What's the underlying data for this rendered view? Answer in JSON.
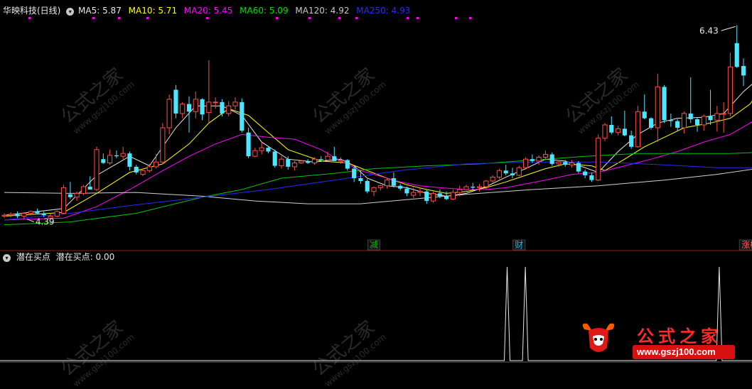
{
  "header": {
    "stock": "华映科技(日线)",
    "ma": [
      {
        "label": "MA5:",
        "value": "5.87",
        "color": "#ffffff"
      },
      {
        "label": "MA10:",
        "value": "5.71",
        "color": "#ffff00"
      },
      {
        "label": "MA20:",
        "value": "5.45",
        "color": "#ff00ff"
      },
      {
        "label": "MA60:",
        "value": "5.09",
        "color": "#00ff00"
      },
      {
        "label": "MA120:",
        "value": "4.92",
        "color": "#c0c0c0"
      },
      {
        "label": "MA250:",
        "value": "4.93",
        "color": "#2020ff"
      }
    ]
  },
  "sub_header": {
    "name": "潜在买点",
    "label": "潜在买点:",
    "value": "0.00"
  },
  "annotations": {
    "high": "6.43",
    "low": "4.39",
    "tags": [
      {
        "text": "减",
        "color": "#00c000"
      },
      {
        "text": "财",
        "color": "#00c0ff"
      },
      {
        "text": "涨榜",
        "color": "#ff6060"
      }
    ]
  },
  "watermark": {
    "cn": "公式之家",
    "url": "www.gszj100.com"
  },
  "logo": {
    "cn": "公式之家",
    "url": "www.gszj100.com"
  },
  "colors": {
    "up": "#ff4d4d",
    "down": "#4de6ff",
    "background": "#000000",
    "divider": "#a01818"
  },
  "chart_data": {
    "type": "candlestick",
    "ylim": [
      4.2,
      6.5
    ],
    "candles": [
      [
        4.42,
        4.45,
        4.4,
        4.43
      ],
      [
        4.43,
        4.46,
        4.41,
        4.44
      ],
      [
        4.44,
        4.47,
        4.4,
        4.42
      ],
      [
        4.42,
        4.46,
        4.39,
        4.45
      ],
      [
        4.45,
        4.48,
        4.43,
        4.47
      ],
      [
        4.47,
        4.5,
        4.44,
        4.45
      ],
      [
        4.45,
        4.47,
        4.41,
        4.43
      ],
      [
        4.4,
        4.45,
        4.39,
        4.42
      ],
      [
        4.42,
        4.48,
        4.41,
        4.47
      ],
      [
        4.45,
        4.75,
        4.44,
        4.72
      ],
      [
        4.65,
        4.78,
        4.6,
        4.62
      ],
      [
        4.62,
        4.68,
        4.58,
        4.66
      ],
      [
        4.66,
        4.75,
        4.64,
        4.73
      ],
      [
        4.73,
        4.84,
        4.7,
        4.7
      ],
      [
        4.7,
        5.15,
        4.68,
        5.12
      ],
      [
        5.02,
        5.08,
        4.97,
        4.98
      ],
      [
        4.98,
        5.12,
        4.96,
        5.06
      ],
      [
        5.06,
        5.11,
        5.03,
        5.05
      ],
      [
        5.05,
        5.15,
        5.02,
        5.08
      ],
      [
        5.08,
        5.1,
        4.9,
        4.94
      ],
      [
        4.94,
        4.96,
        4.86,
        4.88
      ],
      [
        4.86,
        4.92,
        4.84,
        4.9
      ],
      [
        4.9,
        4.97,
        4.88,
        4.94
      ],
      [
        4.94,
        5.07,
        4.92,
        4.99
      ],
      [
        4.99,
        5.4,
        4.98,
        5.35
      ],
      [
        5.35,
        5.7,
        5.28,
        5.65
      ],
      [
        5.75,
        5.8,
        5.45,
        5.5
      ],
      [
        5.5,
        5.62,
        5.45,
        5.6
      ],
      [
        5.6,
        5.68,
        5.3,
        5.52
      ],
      [
        5.52,
        5.73,
        5.45,
        5.65
      ],
      [
        5.65,
        5.66,
        5.43,
        5.49
      ],
      [
        5.51,
        6.06,
        5.4,
        5.62
      ],
      [
        5.62,
        5.67,
        5.55,
        5.62
      ],
      [
        5.62,
        5.65,
        5.47,
        5.5
      ],
      [
        5.5,
        5.63,
        5.47,
        5.58
      ],
      [
        5.58,
        5.67,
        5.54,
        5.62
      ],
      [
        5.62,
        5.66,
        5.3,
        5.32
      ],
      [
        5.3,
        5.35,
        5.03,
        5.05
      ],
      [
        5.05,
        5.14,
        5.04,
        5.11
      ],
      [
        5.11,
        5.2,
        5.07,
        5.14
      ],
      [
        5.14,
        5.16,
        5.08,
        5.1
      ],
      [
        5.1,
        5.12,
        4.93,
        4.95
      ],
      [
        4.95,
        5.05,
        4.92,
        5.02
      ],
      [
        5.02,
        5.05,
        4.91,
        4.94
      ],
      [
        4.94,
        5.0,
        4.9,
        4.98
      ],
      [
        4.98,
        5.01,
        4.97,
        5.0
      ],
      [
        5.0,
        5.02,
        4.97,
        4.98
      ],
      [
        4.98,
        5.04,
        4.96,
        5.02
      ],
      [
        5.02,
        5.05,
        4.99,
        5.01
      ],
      [
        5.01,
        5.1,
        5.0,
        5.05
      ],
      [
        5.05,
        5.15,
        5.0,
        5.0
      ],
      [
        5.0,
        5.04,
        4.97,
        5.01
      ],
      [
        5.01,
        5.02,
        4.9,
        4.92
      ],
      [
        4.92,
        4.94,
        4.78,
        4.82
      ],
      [
        4.82,
        4.9,
        4.76,
        4.79
      ],
      [
        4.79,
        4.81,
        4.66,
        4.68
      ],
      [
        4.68,
        4.73,
        4.63,
        4.72
      ],
      [
        4.72,
        4.75,
        4.69,
        4.74
      ],
      [
        4.74,
        4.82,
        4.71,
        4.8
      ],
      [
        4.82,
        4.88,
        4.72,
        4.74
      ],
      [
        4.74,
        4.76,
        4.69,
        4.71
      ],
      [
        4.71,
        4.73,
        4.63,
        4.66
      ],
      [
        4.64,
        4.72,
        4.61,
        4.67
      ],
      [
        4.67,
        4.72,
        4.63,
        4.68
      ],
      [
        4.68,
        4.7,
        4.55,
        4.58
      ],
      [
        4.58,
        4.68,
        4.56,
        4.66
      ],
      [
        4.66,
        4.7,
        4.61,
        4.63
      ],
      [
        4.63,
        4.68,
        4.59,
        4.6
      ],
      [
        4.6,
        4.7,
        4.59,
        4.67
      ],
      [
        4.67,
        4.74,
        4.63,
        4.7
      ],
      [
        4.7,
        4.75,
        4.69,
        4.73
      ],
      [
        4.73,
        4.77,
        4.7,
        4.72
      ],
      [
        4.72,
        4.76,
        4.68,
        4.73
      ],
      [
        4.73,
        4.8,
        4.7,
        4.79
      ],
      [
        4.79,
        4.85,
        4.77,
        4.83
      ],
      [
        4.83,
        4.92,
        4.81,
        4.9
      ],
      [
        4.9,
        4.96,
        4.85,
        4.87
      ],
      [
        4.87,
        4.93,
        4.82,
        4.85
      ],
      [
        4.85,
        4.95,
        4.84,
        4.93
      ],
      [
        4.93,
        5.04,
        4.91,
        5.02
      ],
      [
        5.02,
        5.07,
        4.98,
        5.0
      ],
      [
        5.0,
        5.06,
        4.96,
        5.04
      ],
      [
        5.04,
        5.11,
        5.01,
        5.07
      ],
      [
        5.07,
        5.09,
        4.95,
        4.97
      ],
      [
        4.97,
        5.01,
        4.94,
        4.99
      ],
      [
        4.99,
        5.01,
        4.94,
        4.96
      ],
      [
        4.96,
        5.01,
        4.93,
        4.98
      ],
      [
        4.98,
        5.0,
        4.87,
        4.89
      ],
      [
        4.89,
        4.91,
        4.82,
        4.85
      ],
      [
        4.85,
        4.88,
        4.78,
        4.8
      ],
      [
        4.8,
        5.28,
        4.79,
        5.24
      ],
      [
        5.24,
        5.4,
        5.21,
        5.38
      ],
      [
        5.38,
        5.47,
        5.28,
        5.3
      ],
      [
        5.3,
        5.37,
        5.27,
        5.34
      ],
      [
        5.34,
        5.53,
        5.26,
        5.27
      ],
      [
        5.27,
        5.32,
        5.13,
        5.15
      ],
      [
        5.15,
        5.58,
        5.14,
        5.52
      ],
      [
        5.52,
        5.7,
        5.44,
        5.45
      ],
      [
        5.45,
        5.46,
        5.33,
        5.35
      ],
      [
        5.35,
        5.92,
        5.2,
        5.78
      ],
      [
        5.78,
        5.8,
        5.4,
        5.43
      ],
      [
        5.43,
        5.5,
        5.36,
        5.42
      ],
      [
        5.42,
        5.44,
        5.32,
        5.35
      ],
      [
        5.35,
        5.52,
        5.29,
        5.5
      ],
      [
        5.5,
        5.88,
        5.4,
        5.44
      ],
      [
        5.44,
        5.46,
        5.31,
        5.38
      ],
      [
        5.38,
        5.49,
        5.32,
        5.47
      ],
      [
        5.47,
        5.75,
        5.38,
        5.43
      ],
      [
        5.43,
        5.58,
        5.31,
        5.5
      ],
      [
        5.5,
        5.62,
        5.3,
        5.5
      ],
      [
        5.5,
        6.14,
        5.47,
        5.99
      ],
      [
        6.24,
        6.43,
        5.98,
        5.99
      ],
      [
        6.0,
        6.08,
        5.79,
        5.9
      ]
    ],
    "ma": {
      "MA5": {
        "color": "#e8e8e8",
        "points": [
          [
            0,
            4.43
          ],
          [
            9,
            4.5
          ],
          [
            14,
            4.85
          ],
          [
            19,
            5.05
          ],
          [
            22,
            4.95
          ],
          [
            26,
            5.35
          ],
          [
            29,
            5.58
          ],
          [
            33,
            5.58
          ],
          [
            36,
            5.48
          ],
          [
            39,
            5.2
          ],
          [
            43,
            5.02
          ],
          [
            47,
            4.99
          ],
          [
            51,
            5.02
          ],
          [
            53,
            4.95
          ],
          [
            55,
            4.82
          ],
          [
            58,
            4.74
          ],
          [
            61,
            4.72
          ],
          [
            64,
            4.66
          ],
          [
            67,
            4.63
          ],
          [
            70,
            4.66
          ],
          [
            73,
            4.73
          ],
          [
            76,
            4.83
          ],
          [
            79,
            4.92
          ],
          [
            82,
            5.02
          ],
          [
            85,
            5.0
          ],
          [
            88,
            4.93
          ],
          [
            90,
            4.88
          ],
          [
            93,
            5.1
          ],
          [
            96,
            5.28
          ],
          [
            99,
            5.4
          ],
          [
            102,
            5.45
          ],
          [
            106,
            5.46
          ],
          [
            109,
            5.5
          ],
          [
            112,
            5.73
          ],
          [
            114,
            5.85
          ]
        ]
      },
      "MA10": {
        "color": "#ffff00",
        "points": [
          [
            0,
            4.42
          ],
          [
            9,
            4.46
          ],
          [
            14,
            4.66
          ],
          [
            19,
            4.88
          ],
          [
            24,
            4.97
          ],
          [
            28,
            5.18
          ],
          [
            31,
            5.4
          ],
          [
            34,
            5.55
          ],
          [
            37,
            5.48
          ],
          [
            40,
            5.3
          ],
          [
            43,
            5.12
          ],
          [
            48,
            5.0
          ],
          [
            52,
            4.98
          ],
          [
            55,
            4.9
          ],
          [
            58,
            4.82
          ],
          [
            61,
            4.75
          ],
          [
            64,
            4.7
          ],
          [
            67,
            4.66
          ],
          [
            70,
            4.68
          ],
          [
            73,
            4.72
          ],
          [
            76,
            4.78
          ],
          [
            79,
            4.85
          ],
          [
            82,
            4.92
          ],
          [
            85,
            4.97
          ],
          [
            89,
            4.95
          ],
          [
            91,
            4.9
          ],
          [
            94,
            5.02
          ],
          [
            97,
            5.15
          ],
          [
            100,
            5.25
          ],
          [
            103,
            5.35
          ],
          [
            107,
            5.4
          ],
          [
            110,
            5.45
          ],
          [
            113,
            5.6
          ],
          [
            114,
            5.7
          ]
        ]
      },
      "MA20": {
        "color": "#ff00ff",
        "points": [
          [
            0,
            4.38
          ],
          [
            9,
            4.4
          ],
          [
            14,
            4.52
          ],
          [
            19,
            4.7
          ],
          [
            24,
            4.9
          ],
          [
            28,
            5.05
          ],
          [
            32,
            5.18
          ],
          [
            36,
            5.28
          ],
          [
            40,
            5.25
          ],
          [
            44,
            5.23
          ],
          [
            48,
            5.12
          ],
          [
            51,
            5.0
          ],
          [
            54,
            4.9
          ],
          [
            57,
            4.84
          ],
          [
            60,
            4.78
          ],
          [
            63,
            4.74
          ],
          [
            66,
            4.72
          ],
          [
            70,
            4.7
          ],
          [
            73,
            4.7
          ],
          [
            76,
            4.72
          ],
          [
            79,
            4.76
          ],
          [
            82,
            4.8
          ],
          [
            86,
            4.86
          ],
          [
            90,
            4.88
          ],
          [
            94,
            4.95
          ],
          [
            98,
            5.02
          ],
          [
            102,
            5.1
          ],
          [
            106,
            5.2
          ],
          [
            110,
            5.28
          ],
          [
            113,
            5.4
          ],
          [
            114,
            5.45
          ]
        ]
      },
      "MA60": {
        "color": "#00c800",
        "points": [
          [
            0,
            4.33
          ],
          [
            10,
            4.36
          ],
          [
            20,
            4.45
          ],
          [
            30,
            4.62
          ],
          [
            36,
            4.7
          ],
          [
            42,
            4.82
          ],
          [
            50,
            4.87
          ],
          [
            56,
            4.92
          ],
          [
            64,
            4.95
          ],
          [
            72,
            4.97
          ],
          [
            80,
            5.01
          ],
          [
            88,
            5.05
          ],
          [
            96,
            5.08
          ],
          [
            104,
            5.08
          ],
          [
            110,
            5.08
          ],
          [
            114,
            5.09
          ]
        ]
      },
      "MA120": {
        "color": "#d0d0d0",
        "points": [
          [
            0,
            4.67
          ],
          [
            10,
            4.66
          ],
          [
            20,
            4.67
          ],
          [
            30,
            4.63
          ],
          [
            38,
            4.58
          ],
          [
            46,
            4.55
          ],
          [
            54,
            4.55
          ],
          [
            62,
            4.6
          ],
          [
            70,
            4.65
          ],
          [
            80,
            4.7
          ],
          [
            90,
            4.74
          ],
          [
            100,
            4.8
          ],
          [
            108,
            4.86
          ],
          [
            114,
            4.92
          ]
        ]
      },
      "MA250": {
        "color": "#2828ff",
        "points": [
          [
            0,
            4.38
          ],
          [
            10,
            4.45
          ],
          [
            20,
            4.54
          ],
          [
            30,
            4.62
          ],
          [
            40,
            4.7
          ],
          [
            50,
            4.8
          ],
          [
            60,
            4.9
          ],
          [
            70,
            4.97
          ],
          [
            80,
            4.99
          ],
          [
            90,
            4.99
          ],
          [
            100,
            4.96
          ],
          [
            108,
            4.93
          ],
          [
            114,
            4.93
          ]
        ]
      }
    },
    "indicator": {
      "name": "潜在买点",
      "ylim": [
        0,
        1
      ],
      "spikes": [
        83,
        86,
        118
      ]
    }
  }
}
